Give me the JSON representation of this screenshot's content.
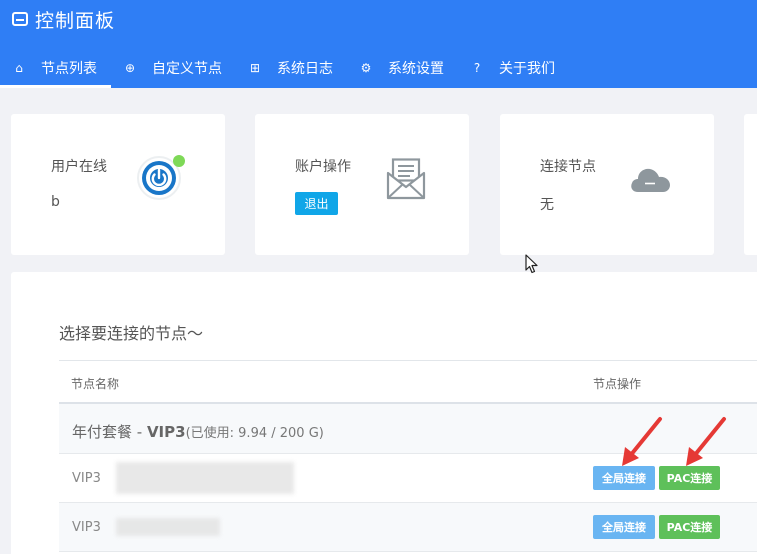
{
  "app": {
    "title": "控制面板",
    "brand_icon": "inbox-icon"
  },
  "nav": [
    {
      "label": "节点列表",
      "icon": "home-icon",
      "glyph": "⌂",
      "active": true
    },
    {
      "label": "自定义节点",
      "icon": "plus-circle-icon",
      "glyph": "⊕"
    },
    {
      "label": "系统日志",
      "icon": "add-square-icon",
      "glyph": "⊞"
    },
    {
      "label": "系统设置",
      "icon": "gear-icon",
      "glyph": "⚙"
    },
    {
      "label": "关于我们",
      "icon": "question-icon",
      "glyph": "?"
    }
  ],
  "cards": {
    "user": {
      "label": "用户在线",
      "value": "b",
      "icon": "power-icon"
    },
    "account": {
      "label": "账户操作",
      "button": "退出",
      "icon": "mail-icon"
    },
    "connect": {
      "label": "连接节点",
      "value": "无",
      "icon": "cloud-minus-icon"
    }
  },
  "nodes": {
    "title": "选择要连接的节点～",
    "columns": [
      "节点名称",
      "节点操作"
    ],
    "group": {
      "name_prefix": "年付套餐 - ",
      "name_bold": "VIP3",
      "usage": "(已使用: 9.94 / 200 G)"
    },
    "rows": [
      {
        "name": "VIP3",
        "global_btn": "全局连接",
        "pac_btn": "PAC连接"
      },
      {
        "name": "VIP3",
        "global_btn": "全局连接",
        "pac_btn": "PAC连接"
      }
    ]
  },
  "colors": {
    "header": "#2f7ef5",
    "global_btn": "#69b5f2",
    "pac_btn": "#5ec05a",
    "logout_btn": "#10a6e8",
    "arrow": "#e53935"
  }
}
